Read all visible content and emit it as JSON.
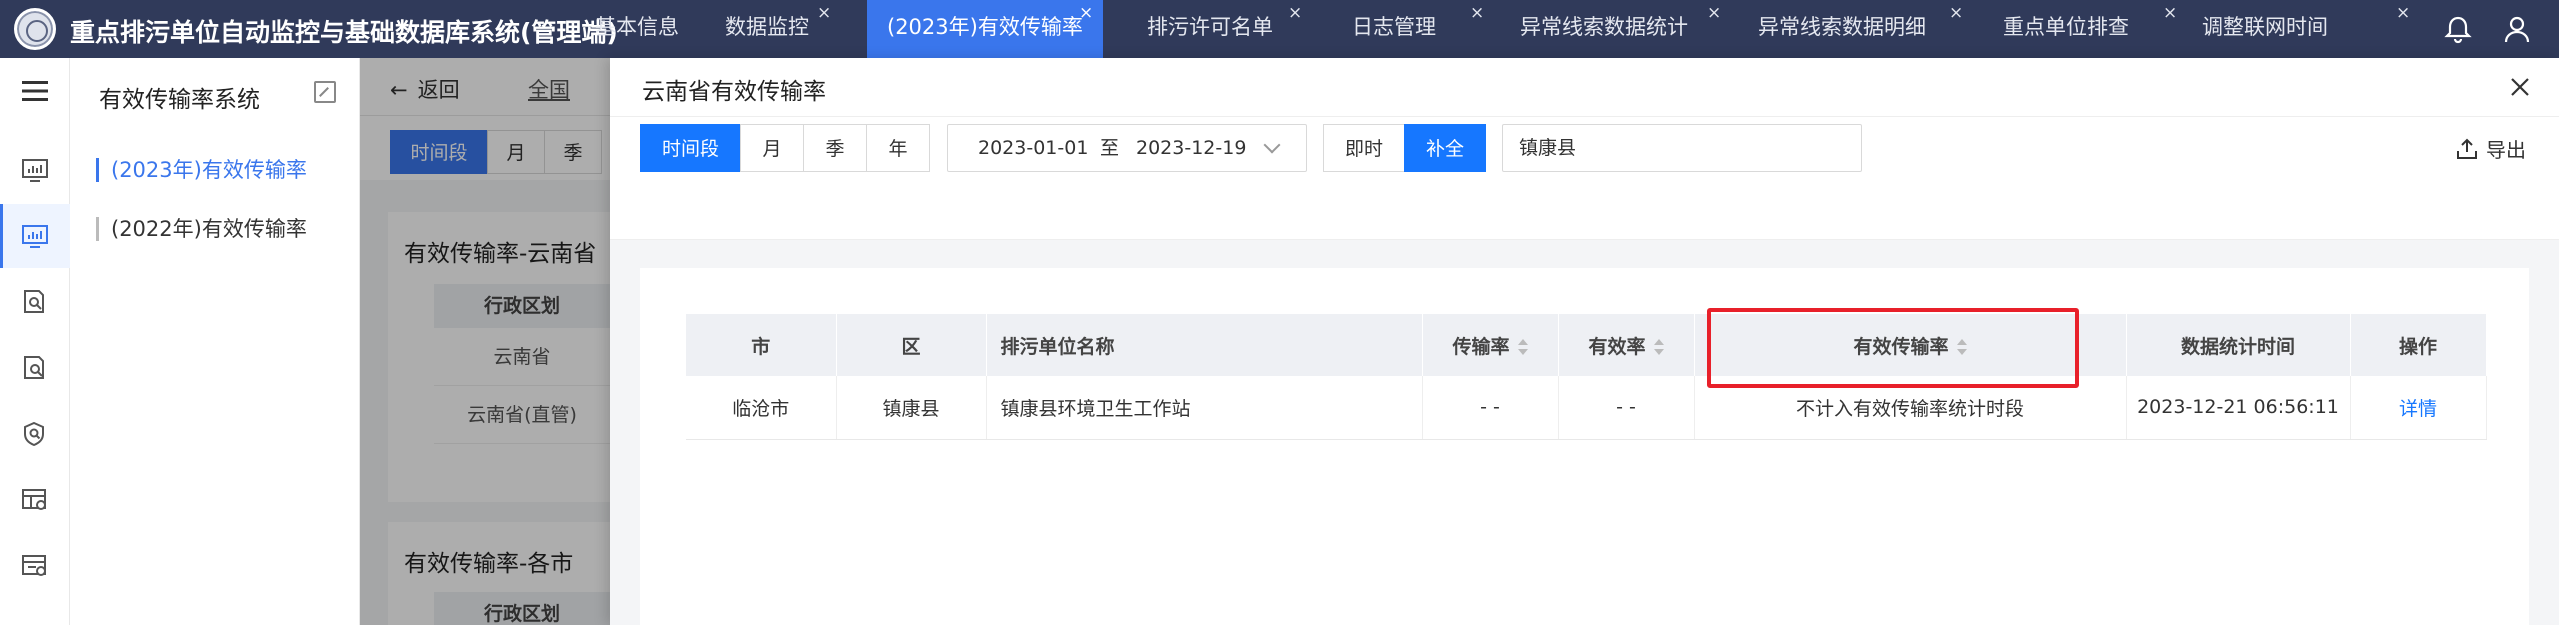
{
  "app": {
    "title": "重点排污单位自动监控与基础数据库系统(管理端)"
  },
  "tabs": [
    {
      "label": "基本信息",
      "closable": false
    },
    {
      "label": "数据监控",
      "closable": true
    },
    {
      "label": "(2023年)有效传输率",
      "closable": true,
      "active": true
    },
    {
      "label": "排污许可名单",
      "closable": true
    },
    {
      "label": "日志管理",
      "closable": true
    },
    {
      "label": "异常线索数据统计",
      "closable": true
    },
    {
      "label": "异常线索数据明细",
      "closable": true
    },
    {
      "label": "重点单位排查",
      "closable": true
    },
    {
      "label": "调整联网时间",
      "closable": true
    }
  ],
  "tab_close_glyph": "×",
  "rail_icons": [
    "monitor-chart-icon",
    "bar-chart-icon",
    "doc-search-icon",
    "file-search-icon",
    "shield-search-icon",
    "data-table-icon",
    "report-icon"
  ],
  "menu": {
    "title": "有效传输率系统",
    "items": [
      {
        "label": "(2023年)有效传输率",
        "active": true
      },
      {
        "label": "(2022年)有效传输率",
        "active": false
      }
    ]
  },
  "under": {
    "back": "返回",
    "crumb": "全国",
    "segments": [
      "时间段",
      "月",
      "季"
    ],
    "card1_title": "有效传输率-云南省",
    "card1_th": "行政区划",
    "card1_rows": [
      "云南省",
      "云南省(直管)"
    ],
    "card2_title": "有效传输率-各市",
    "card2_th": "行政区划"
  },
  "drawer": {
    "title": "云南省有效传输率",
    "period_segments": [
      "时间段",
      "月",
      "季",
      "年"
    ],
    "date_start": "2023-01-01",
    "date_sep": "至",
    "date_end": "2023-12-19",
    "mode_segments": [
      "即时",
      "补全"
    ],
    "region_value": "镇康县",
    "export_label": "导出"
  },
  "table": {
    "headers": [
      "市",
      "区",
      "排污单位名称",
      "传输率",
      "有效率",
      "有效传输率",
      "数据统计时间",
      "操作"
    ],
    "rows": [
      {
        "city": "临沧市",
        "district": "镇康县",
        "unit": "镇康县环境卫生工作站",
        "transfer_rate": "- -",
        "valid_rate": "- -",
        "effective_rate": "不计入有效传输率统计时段",
        "stat_time": "2023-12-21 06:56:11",
        "action": "详情"
      }
    ]
  },
  "colors": {
    "accent": "#1677ff",
    "topbar": "#303a5a",
    "highlight": "#e8202a"
  }
}
